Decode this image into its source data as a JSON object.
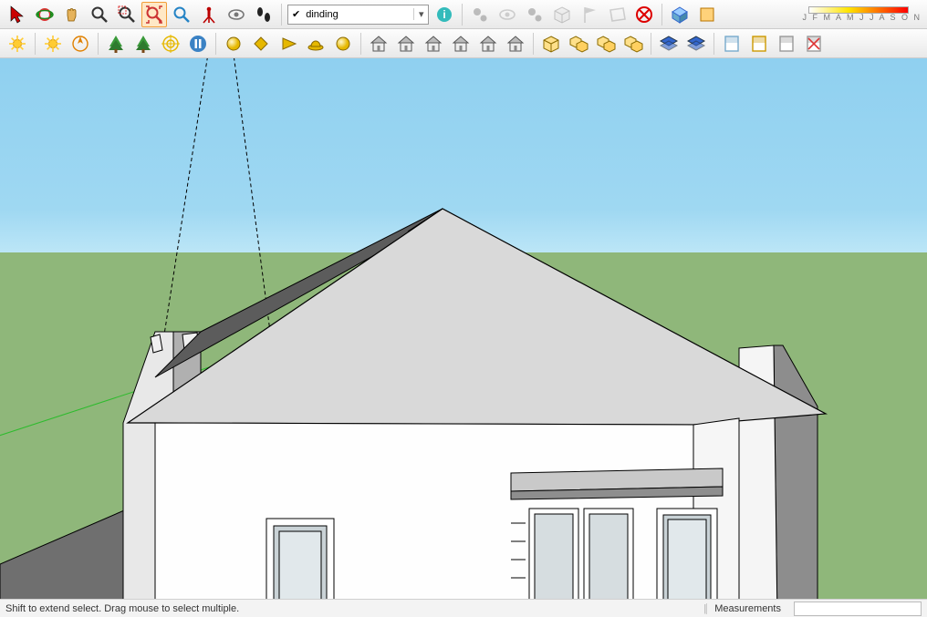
{
  "toolbars": {
    "row1": [
      {
        "name": "select-icon",
        "title": "Select",
        "svg": "cursor",
        "color": "#c00"
      },
      {
        "name": "orbit-icon",
        "title": "Orbit",
        "svg": "orbit",
        "color": "#d33"
      },
      {
        "name": "pan-icon",
        "title": "Pan",
        "svg": "hand",
        "color": "#e6b35c"
      },
      {
        "name": "zoom-icon",
        "title": "Zoom",
        "svg": "mag",
        "color": "#333"
      },
      {
        "name": "zoom-window-icon",
        "title": "Zoom Window",
        "svg": "magbox",
        "color": "#333"
      },
      {
        "name": "zoom-extents-icon",
        "title": "Zoom Extents",
        "svg": "magarrows",
        "color": "#c33",
        "active": true
      },
      {
        "name": "zoom-prev-icon",
        "title": "Previous",
        "svg": "mag",
        "color": "#2483c5"
      },
      {
        "name": "position-camera-icon",
        "title": "Position Camera",
        "svg": "mantripod",
        "color": "#b00"
      },
      {
        "name": "look-around-icon",
        "title": "Look Around",
        "svg": "eye",
        "color": "#777"
      },
      {
        "name": "walk-icon",
        "title": "Walk",
        "svg": "feet",
        "color": "#222"
      },
      {
        "sep": true
      },
      {
        "combo": true
      },
      {
        "name": "layer-info-icon",
        "title": "Layer Info",
        "svg": "info",
        "color": "#2b7"
      },
      {
        "sep": true
      },
      {
        "name": "gear1-icon",
        "title": "Plugin",
        "svg": "gears",
        "color": "#555",
        "dim": true
      },
      {
        "name": "eye2-icon",
        "title": "View",
        "svg": "eye",
        "color": "#888",
        "dim": true
      },
      {
        "name": "gear2-icon",
        "title": "Plugin",
        "svg": "gears",
        "color": "#555",
        "dim": true
      },
      {
        "name": "cube-icon",
        "title": "Component",
        "svg": "box",
        "color": "#888",
        "dim": true
      },
      {
        "name": "flag-icon",
        "title": "Flag",
        "svg": "flag",
        "color": "#888",
        "dim": true
      },
      {
        "name": "poly-icon",
        "title": "Poly",
        "svg": "quad",
        "color": "#888",
        "dim": true
      },
      {
        "name": "cancel-icon",
        "title": "Cancel",
        "svg": "xcircle",
        "color": "#d00"
      },
      {
        "sep": true
      },
      {
        "name": "iso-icon",
        "title": "Iso",
        "svg": "iso",
        "color": "#49f"
      },
      {
        "name": "front-icon",
        "title": "Front",
        "svg": "front",
        "color": "#e80"
      },
      {
        "gradient": true
      }
    ],
    "row2": [
      {
        "name": "shadow-icon",
        "title": "Shadows",
        "svg": "sun",
        "color": "#ffb000"
      },
      {
        "sep": true
      },
      {
        "name": "sun-icon",
        "title": "Sun",
        "svg": "sun",
        "color": "#ffb000"
      },
      {
        "name": "north-icon",
        "title": "North",
        "svg": "compass",
        "color": "#e08000"
      },
      {
        "sep": true
      },
      {
        "name": "tree1-icon",
        "title": "Tree",
        "svg": "tree",
        "color": "#2a8a2a"
      },
      {
        "name": "tree2-icon",
        "title": "Tree",
        "svg": "tree",
        "color": "#2a8a2a"
      },
      {
        "name": "target-icon",
        "title": "Target",
        "svg": "target",
        "color": "#e6b800"
      },
      {
        "name": "pause-icon",
        "title": "Pause",
        "svg": "pause",
        "color": "#2b6cb0"
      },
      {
        "sep": true
      },
      {
        "name": "sphere-icon",
        "title": "Sphere",
        "svg": "ball",
        "color": "#e6b800"
      },
      {
        "name": "plane-icon",
        "title": "Plane",
        "svg": "diamond",
        "color": "#e6b800"
      },
      {
        "name": "arrow-icon",
        "title": "Arrow",
        "svg": "tri",
        "color": "#e6b800"
      },
      {
        "name": "hardhat-icon",
        "title": "Man",
        "svg": "hat",
        "color": "#e6b800"
      },
      {
        "name": "sphere2-icon",
        "title": "Sphere",
        "svg": "ball",
        "color": "#e6b800"
      },
      {
        "sep": true
      },
      {
        "name": "house1-icon",
        "title": "House",
        "svg": "house",
        "color": "#777"
      },
      {
        "name": "house2-icon",
        "title": "House",
        "svg": "house",
        "color": "#777"
      },
      {
        "name": "house3-icon",
        "title": "House",
        "svg": "house",
        "color": "#777"
      },
      {
        "name": "house4-icon",
        "title": "House",
        "svg": "house",
        "color": "#777"
      },
      {
        "name": "house5-icon",
        "title": "House",
        "svg": "house",
        "color": "#777"
      },
      {
        "name": "house6-icon",
        "title": "House",
        "svg": "house",
        "color": "#777"
      },
      {
        "sep": true
      },
      {
        "name": "boxa-icon",
        "title": "Box",
        "svg": "box",
        "color": "#c90"
      },
      {
        "name": "boxb-icon",
        "title": "Box",
        "svg": "boxes",
        "color": "#c90"
      },
      {
        "name": "boxc-icon",
        "title": "Box",
        "svg": "boxes",
        "color": "#c90"
      },
      {
        "name": "boxd-icon",
        "title": "Box",
        "svg": "boxes",
        "color": "#c90"
      },
      {
        "sep": true
      },
      {
        "name": "layer1-icon",
        "title": "Layer",
        "svg": "layers",
        "color": "#36c"
      },
      {
        "name": "layer2-icon",
        "title": "Layer",
        "svg": "layers",
        "color": "#36c"
      },
      {
        "sep": true
      },
      {
        "name": "sheet1-icon",
        "title": "Sheet",
        "svg": "sheet",
        "color": "#7ac"
      },
      {
        "name": "sheet2-icon",
        "title": "Sheet",
        "svg": "sheet",
        "color": "#c90"
      },
      {
        "name": "sheet3-icon",
        "title": "Sheet",
        "svg": "sheet",
        "color": "#999"
      },
      {
        "name": "sheet4-icon",
        "title": "Sheet",
        "svg": "sheetx",
        "color": "#999"
      }
    ]
  },
  "layer_combo": {
    "checked": true,
    "value": "dinding"
  },
  "months_label": "J F M A M J J A S O N",
  "status": {
    "hint": "Shift to extend select. Drag mouse to select multiple.",
    "measurements_label": "Measurements",
    "measurements_value": ""
  }
}
